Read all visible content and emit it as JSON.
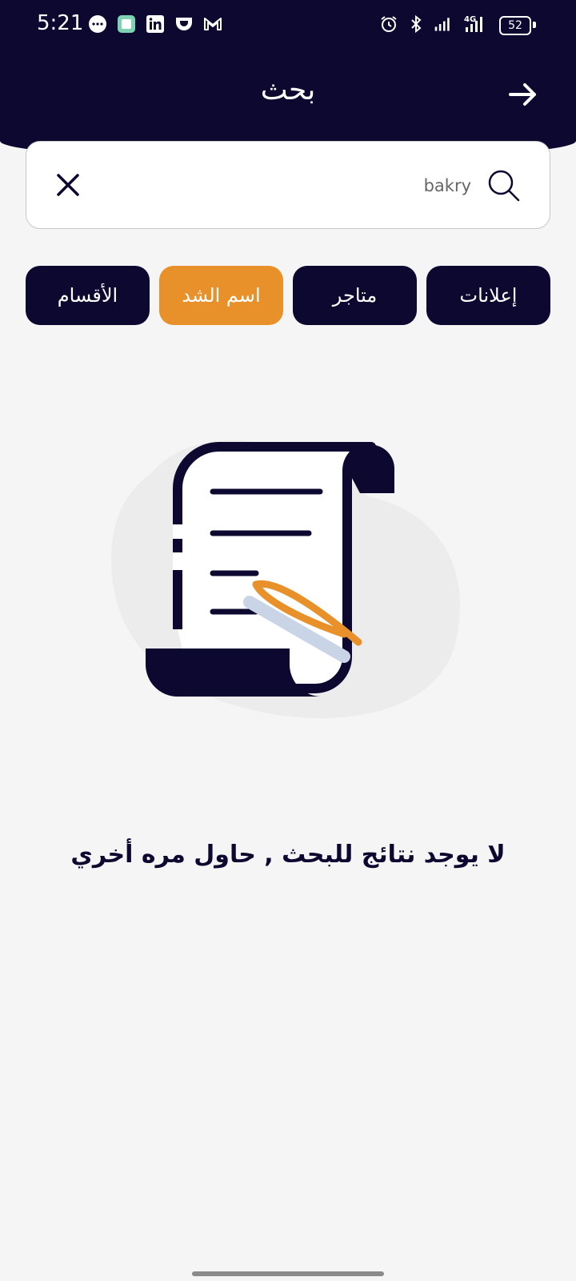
{
  "status_bar": {
    "time": "5:21",
    "battery": "52",
    "network": "4G",
    "left_icons": [
      "chat-bubble-icon",
      "app-square-icon",
      "linkedin-icon",
      "cup-icon",
      "gmail-icon"
    ],
    "right_icons": [
      "alarm-icon",
      "bluetooth-icon",
      "signal-icon",
      "signal-4g-icon",
      "battery-icon"
    ]
  },
  "header": {
    "title": "بحث",
    "back_icon": "arrow-right-icon",
    "background": "#0d0830"
  },
  "search": {
    "value": "bakry",
    "placeholder": "",
    "search_icon": "search-icon",
    "clear_icon": "close-icon"
  },
  "tabs": [
    {
      "label": "إعلانات",
      "active": false
    },
    {
      "label": "متاجر",
      "active": false
    },
    {
      "label": "اسم الشد",
      "active": true
    },
    {
      "label": "الأقسام",
      "active": false
    }
  ],
  "empty_state": {
    "illustration": "scroll-document-pen-illustration",
    "message": "لا يوجد نتائج للبحث , حاول مره أخري"
  },
  "colors": {
    "primary": "#0d0830",
    "accent": "#e8912a",
    "background": "#f5f5f5"
  }
}
